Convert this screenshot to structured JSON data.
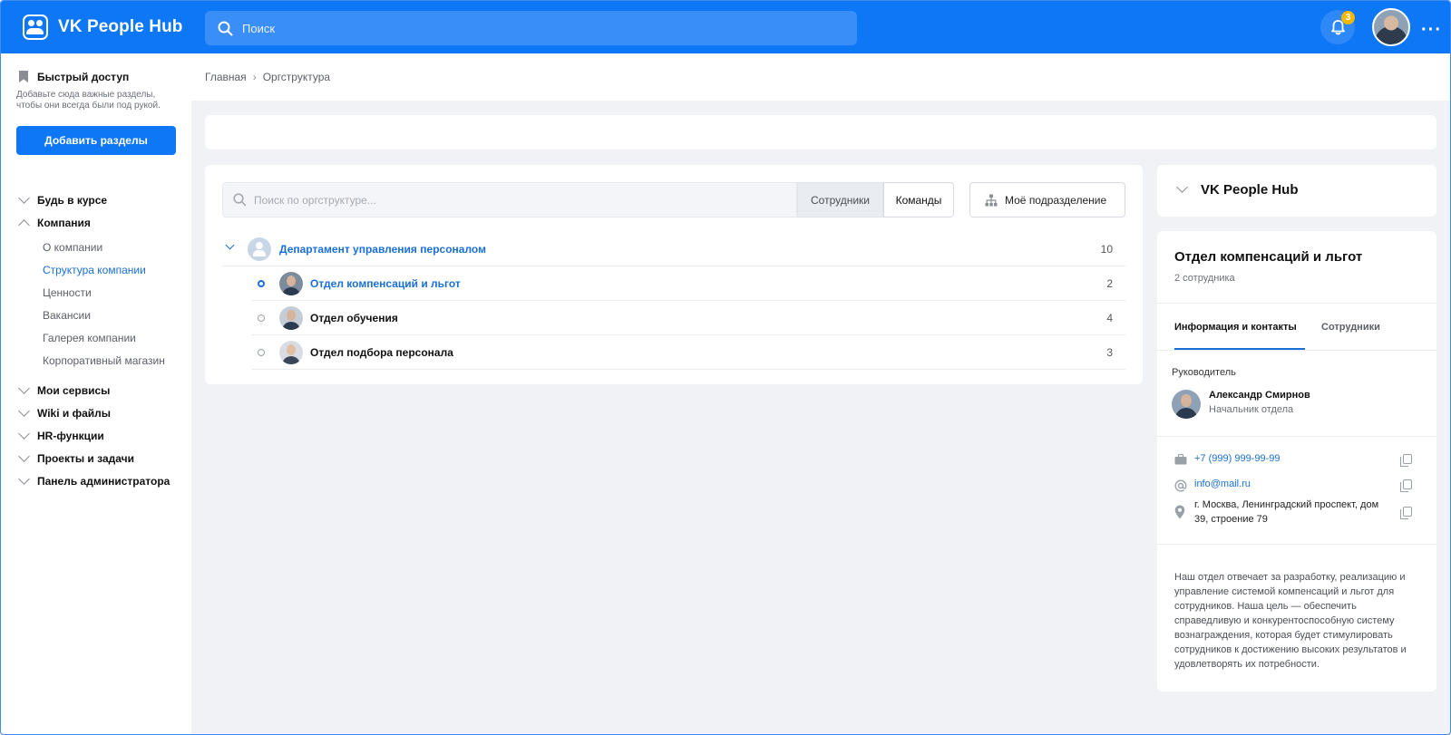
{
  "app": {
    "title": "VK People Hub"
  },
  "header": {
    "search_placeholder": "Поиск",
    "notifications_count": "3"
  },
  "sidebar": {
    "quick_access_title": "Быстрый доступ",
    "quick_access_desc": "Добавьте сюда важные разделы, чтобы они всегда были под рукой.",
    "add_button": "Добавить разделы",
    "items": [
      {
        "label": "Будь в курсе",
        "expanded": false
      },
      {
        "label": "Компания",
        "expanded": true
      },
      {
        "label": "Мои сервисы",
        "expanded": false
      },
      {
        "label": "Wiki и файлы",
        "expanded": false
      },
      {
        "label": "HR-функции",
        "expanded": false
      },
      {
        "label": "Проекты и задачи",
        "expanded": false
      },
      {
        "label": "Панель администратора",
        "expanded": false
      }
    ],
    "company_sub": [
      "О компании",
      "Структура компании",
      "Ценности",
      "Вакансии",
      "Галерея компании",
      "Корпоративный магазин"
    ],
    "active_sub": "Структура компании"
  },
  "breadcrumb": {
    "home": "Главная",
    "current": "Оргструктура"
  },
  "org": {
    "search_placeholder": "Поиск по оргструктуре...",
    "segment_employees": "Сотрудники",
    "segment_teams": "Команды",
    "my_department": "Моё подразделение",
    "department": {
      "name": "Департамент управления персоналом",
      "count": "10"
    },
    "subdepartments": [
      {
        "name": "Отдел компенсаций и льгот",
        "count": "2",
        "active": true
      },
      {
        "name": "Отдел обучения",
        "count": "4",
        "active": false
      },
      {
        "name": "Отдел подбора персонала",
        "count": "3",
        "active": false
      }
    ]
  },
  "panel": {
    "org_name": "VK People Hub",
    "dept_name": "Отдел компенсаций и льгот",
    "dept_count": "2 сотрудника",
    "tab_info": "Информация и контакты",
    "tab_employees": "Сотрудники",
    "manager_label": "Руководитель",
    "manager_name": "Александр Смирнов",
    "manager_role": "Начальник отдела",
    "phone": "+7 (999) 999-99-99",
    "email": "info@mail.ru",
    "address": "г. Москва, Ленинградский проспект, дом 39, строение 79",
    "description": "Наш отдел отвечает за разработку, реализацию и управление системой компенсаций и льгот для сотрудников. Наша цель — обеспечить справедливую и конкурентоспособную систему вознаграждения, которая будет стимулировать сотрудников к достижению высоких результатов и удовлетворять их потребности."
  },
  "colors": {
    "brand": "#0d77f6",
    "link": "#1a6fd6",
    "badge": "#f5b800"
  }
}
